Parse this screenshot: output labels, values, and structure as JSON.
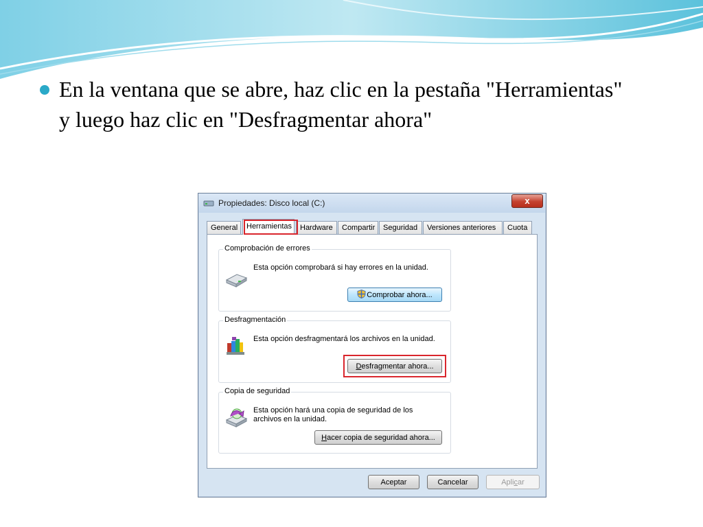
{
  "slide": {
    "bullet_text": "En la ventana que se abre, haz clic en la pestaña \"Herramientas\" y luego haz clic en \"Desfragmentar ahora\"",
    "accent_color": "#2aa9c8"
  },
  "dialog": {
    "title": "Propiedades: Disco local (C:)",
    "close_label": "x",
    "tabs": [
      {
        "label": "General"
      },
      {
        "label": "Herramientas",
        "active": true
      },
      {
        "label": "Hardware"
      },
      {
        "label": "Compartir"
      },
      {
        "label": "Seguridad"
      },
      {
        "label": "Versiones anteriores"
      },
      {
        "label": "Cuota"
      }
    ],
    "groups": {
      "errors": {
        "label": "Comprobación de errores",
        "text": "Esta opción comprobará si hay errores en la unidad.",
        "button": "Comprobar ahora..."
      },
      "defrag": {
        "label": "Desfragmentación",
        "text": "Esta opción desfragmentará los archivos en la unidad.",
        "button_prefix": "D",
        "button_rest": "esfragmentar ahora..."
      },
      "backup": {
        "label": "Copia de seguridad",
        "text": "Esta opción hará una copia de seguridad de los archivos en la unidad.",
        "button_prefix": "H",
        "button_rest": "acer copia de seguridad ahora..."
      }
    },
    "footer": {
      "ok": "Aceptar",
      "cancel": "Cancelar",
      "apply_prefix": "Apli",
      "apply_underlined": "c",
      "apply_suffix": "ar"
    },
    "highlight_color": "#d9252c"
  }
}
